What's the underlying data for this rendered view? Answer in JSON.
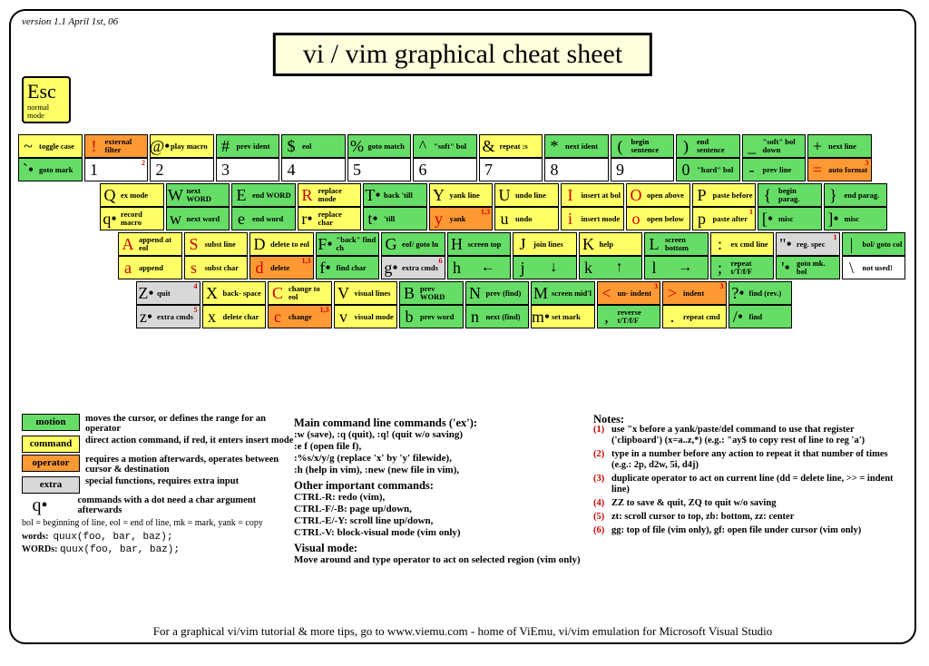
{
  "version": "version 1.1\nApril 1st, 06",
  "title": "vi / vim graphical cheat sheet",
  "esc": {
    "key": "Esc",
    "label": "normal mode"
  },
  "rows": [
    [
      {
        "upper": {
          "c": "~",
          "t": "g-cmd",
          "l": "toggle case"
        },
        "lower": {
          "c": "`•",
          "t": "g-motion",
          "l": "goto mark"
        }
      },
      {
        "upper": {
          "c": "!",
          "t": "g-op",
          "l": "external filter",
          "red": 1
        },
        "lower": {
          "c": "1",
          "t": "g-none",
          "l": "",
          "sup": "2",
          "dbl": 1
        }
      },
      {
        "upper": {
          "c": "@•",
          "t": "g-cmd",
          "l": "play macro"
        },
        "lower": {
          "c": "2",
          "t": "g-none",
          "l": "",
          "dbl": 1
        }
      },
      {
        "upper": {
          "c": "#",
          "t": "g-motion",
          "l": "prev ident"
        },
        "lower": {
          "c": "3",
          "t": "g-none",
          "l": "",
          "dbl": 1
        }
      },
      {
        "upper": {
          "c": "$",
          "t": "g-motion",
          "l": "eol"
        },
        "lower": {
          "c": "4",
          "t": "g-none",
          "l": "",
          "dbl": 1
        }
      },
      {
        "upper": {
          "c": "%",
          "t": "g-motion",
          "l": "goto match"
        },
        "lower": {
          "c": "5",
          "t": "g-none",
          "l": "",
          "dbl": 1
        }
      },
      {
        "upper": {
          "c": "^",
          "t": "g-motion",
          "l": "\"soft\" bol"
        },
        "lower": {
          "c": "6",
          "t": "g-none",
          "l": "",
          "dbl": 1
        }
      },
      {
        "upper": {
          "c": "&",
          "t": "g-cmd",
          "l": "repeat :s"
        },
        "lower": {
          "c": "7",
          "t": "g-none",
          "l": "",
          "dbl": 1
        }
      },
      {
        "upper": {
          "c": "*",
          "t": "g-motion",
          "l": "next ident"
        },
        "lower": {
          "c": "8",
          "t": "g-none",
          "l": "",
          "dbl": 1
        }
      },
      {
        "upper": {
          "c": "(",
          "t": "g-motion",
          "l": "begin sentence"
        },
        "lower": {
          "c": "9",
          "t": "g-none",
          "l": "",
          "dbl": 1
        }
      },
      {
        "upper": {
          "c": ")",
          "t": "g-motion",
          "l": "end sentence"
        },
        "lower": {
          "c": "0",
          "t": "g-motion",
          "l": "\"hard\" bol"
        }
      },
      {
        "upper": {
          "c": "_",
          "t": "g-motion",
          "l": "\"soft\" bol down"
        },
        "lower": {
          "c": "-",
          "t": "g-motion",
          "l": "prev line"
        }
      },
      {
        "upper": {
          "c": "+",
          "t": "g-motion",
          "l": "next line"
        },
        "lower": {
          "c": "=",
          "t": "g-op",
          "l": "auto format",
          "sup": "3",
          "red": 1
        }
      }
    ],
    [
      {
        "upper": {
          "c": "Q",
          "t": "g-cmd",
          "l": "ex mode"
        },
        "lower": {
          "c": "q•",
          "t": "g-cmd",
          "l": "record macro"
        }
      },
      {
        "upper": {
          "c": "W",
          "t": "g-motion",
          "l": "next WORD"
        },
        "lower": {
          "c": "w",
          "t": "g-motion",
          "l": "next word"
        }
      },
      {
        "upper": {
          "c": "E",
          "t": "g-motion",
          "l": "end WORD"
        },
        "lower": {
          "c": "e",
          "t": "g-motion",
          "l": "end word"
        }
      },
      {
        "upper": {
          "c": "R",
          "t": "g-cmd",
          "l": "replace mode",
          "red": 1
        },
        "lower": {
          "c": "r•",
          "t": "g-cmd",
          "l": "replace char"
        }
      },
      {
        "upper": {
          "c": "T•",
          "t": "g-motion",
          "l": "back 'till"
        },
        "lower": {
          "c": "t•",
          "t": "g-motion",
          "l": "'till"
        }
      },
      {
        "upper": {
          "c": "Y",
          "t": "g-cmd",
          "l": "yank line"
        },
        "lower": {
          "c": "y",
          "t": "g-op",
          "l": "yank",
          "sup": "1,3",
          "red": 1
        }
      },
      {
        "upper": {
          "c": "U",
          "t": "g-cmd",
          "l": "undo line"
        },
        "lower": {
          "c": "u",
          "t": "g-cmd",
          "l": "undo"
        }
      },
      {
        "upper": {
          "c": "I",
          "t": "g-cmd",
          "l": "insert at bol",
          "red": 1
        },
        "lower": {
          "c": "i",
          "t": "g-cmd",
          "l": "insert mode",
          "red": 1
        }
      },
      {
        "upper": {
          "c": "O",
          "t": "g-cmd",
          "l": "open above",
          "red": 1
        },
        "lower": {
          "c": "o",
          "t": "g-cmd",
          "l": "open below",
          "red": 1
        }
      },
      {
        "upper": {
          "c": "P",
          "t": "g-cmd",
          "l": "paste before"
        },
        "lower": {
          "c": "p",
          "t": "g-cmd",
          "l": "paste after",
          "sup": "1"
        }
      },
      {
        "upper": {
          "c": "{",
          "t": "g-motion",
          "l": "begin parag."
        },
        "lower": {
          "c": "[•",
          "t": "g-motion",
          "l": "misc"
        }
      },
      {
        "upper": {
          "c": "}",
          "t": "g-motion",
          "l": "end parag."
        },
        "lower": {
          "c": "]•",
          "t": "g-motion",
          "l": "misc"
        }
      }
    ],
    [
      {
        "upper": {
          "c": "A",
          "t": "g-cmd",
          "l": "append at eol",
          "red": 1
        },
        "lower": {
          "c": "a",
          "t": "g-cmd",
          "l": "append",
          "red": 1
        }
      },
      {
        "upper": {
          "c": "S",
          "t": "g-cmd",
          "l": "subst line",
          "red": 1
        },
        "lower": {
          "c": "s",
          "t": "g-cmd",
          "l": "subst char",
          "red": 1
        }
      },
      {
        "upper": {
          "c": "D",
          "t": "g-cmd",
          "l": "delete to eol"
        },
        "lower": {
          "c": "d",
          "t": "g-op",
          "l": "delete",
          "sup": "1,3",
          "red": 1
        }
      },
      {
        "upper": {
          "c": "F•",
          "t": "g-motion",
          "l": "\"back\" find ch"
        },
        "lower": {
          "c": "f•",
          "t": "g-motion",
          "l": "find char"
        }
      },
      {
        "upper": {
          "c": "G",
          "t": "g-motion",
          "l": "eof/ goto ln"
        },
        "lower": {
          "c": "g•",
          "t": "g-extra",
          "l": "extra cmds",
          "sup": "6"
        }
      },
      {
        "upper": {
          "c": "H",
          "t": "g-motion",
          "l": "screen top"
        },
        "lower": {
          "c": "h",
          "t": "g-motion",
          "arrow": "←"
        }
      },
      {
        "upper": {
          "c": "J",
          "t": "g-cmd",
          "l": "join lines"
        },
        "lower": {
          "c": "j",
          "t": "g-motion",
          "arrow": "↓"
        }
      },
      {
        "upper": {
          "c": "K",
          "t": "g-cmd",
          "l": "help"
        },
        "lower": {
          "c": "k",
          "t": "g-motion",
          "arrow": "↑"
        }
      },
      {
        "upper": {
          "c": "L",
          "t": "g-motion",
          "l": "screen bottom"
        },
        "lower": {
          "c": "l",
          "t": "g-motion",
          "arrow": "→"
        }
      },
      {
        "upper": {
          "c": ":",
          "t": "g-cmd",
          "l": "ex cmd line"
        },
        "lower": {
          "c": ";",
          "t": "g-motion",
          "l": "repeat t/T/f/F"
        }
      },
      {
        "upper": {
          "c": "\"•",
          "t": "g-extra",
          "l": "reg. spec",
          "sup": "1"
        },
        "lower": {
          "c": "'•",
          "t": "g-motion",
          "l": "goto mk. bol"
        }
      },
      {
        "upper": {
          "c": "|",
          "t": "g-motion",
          "l": "bol/ goto col"
        },
        "lower": {
          "c": "\\",
          "t": "g-none",
          "l": "not used!"
        }
      }
    ],
    [
      {
        "upper": {
          "c": "Z•",
          "t": "g-extra",
          "l": "quit",
          "sup": "4"
        },
        "lower": {
          "c": "z•",
          "t": "g-extra",
          "l": "extra cmds",
          "sup": "5"
        }
      },
      {
        "upper": {
          "c": "X",
          "t": "g-cmd",
          "l": "back- space"
        },
        "lower": {
          "c": "x",
          "t": "g-cmd",
          "l": "delete char"
        }
      },
      {
        "upper": {
          "c": "C",
          "t": "g-cmd",
          "l": "change to eol",
          "red": 1
        },
        "lower": {
          "c": "c",
          "t": "g-op",
          "l": "change",
          "red": 1,
          "sup": "1,3"
        }
      },
      {
        "upper": {
          "c": "V",
          "t": "g-cmd",
          "l": "visual lines"
        },
        "lower": {
          "c": "v",
          "t": "g-cmd",
          "l": "visual mode"
        }
      },
      {
        "upper": {
          "c": "B",
          "t": "g-motion",
          "l": "prev WORD"
        },
        "lower": {
          "c": "b",
          "t": "g-motion",
          "l": "prev word"
        }
      },
      {
        "upper": {
          "c": "N",
          "t": "g-motion",
          "l": "prev (find)"
        },
        "lower": {
          "c": "n",
          "t": "g-motion",
          "l": "next (find)"
        }
      },
      {
        "upper": {
          "c": "M",
          "t": "g-motion",
          "l": "screen mid'l"
        },
        "lower": {
          "c": "m•",
          "t": "g-cmd",
          "l": "set mark"
        }
      },
      {
        "upper": {
          "c": "<",
          "t": "g-op",
          "l": "un- indent",
          "sup": "3",
          "red": 1
        },
        "lower": {
          "c": ",",
          "t": "g-motion",
          "l": "reverse t/T/f/F"
        }
      },
      {
        "upper": {
          "c": ">",
          "t": "g-op",
          "l": "indent",
          "sup": "3",
          "red": 1
        },
        "lower": {
          "c": ".",
          "t": "g-cmd",
          "l": "repeat cmd"
        }
      },
      {
        "upper": {
          "c": "?•",
          "t": "g-motion",
          "l": "find (rev.)"
        },
        "lower": {
          "c": "/•",
          "t": "g-motion",
          "l": "find"
        }
      }
    ]
  ],
  "row_offset": [
    0,
    90,
    110,
    130
  ],
  "legend": [
    {
      "t": "g-motion",
      "n": "motion",
      "d": "moves the cursor, or defines the range for an operator"
    },
    {
      "t": "g-cmd",
      "n": "command",
      "d": "direct action command, if red, it enters insert mode"
    },
    {
      "t": "g-op",
      "n": "operator",
      "d": "requires a motion afterwards, operates between cursor & destination"
    },
    {
      "t": "g-extra",
      "n": "extra",
      "d": "special functions, requires extra input"
    }
  ],
  "qdot": "commands with a dot need a char argument afterwards",
  "abbrev": "bol = beginning of line, eol = end of line, mk = mark, yank = copy",
  "words_label": "words:",
  "WORDS_label": "WORDs:",
  "wexample": "quux(foo, bar, baz);",
  "main_h": "Main command line commands ('ex'):",
  "main_lines": [
    ":w (save), :q (quit), :q! (quit w/o saving)",
    ":e f (open file f),",
    ":%s/x/y/g (replace 'x' by 'y' filewide),",
    ":h (help in vim), :new (new file in vim),"
  ],
  "other_h": "Other important commands:",
  "other_lines": [
    "CTRL-R: redo (vim),",
    "CTRL-F/-B: page up/down,",
    "CTRL-E/-Y: scroll line up/down,",
    "CTRL-V: block-visual mode (vim only)"
  ],
  "visual_h": "Visual mode:",
  "visual_lines": [
    "Move around and type operator to act on selected region (vim only)"
  ],
  "notes_h": "Notes:",
  "notes": [
    {
      "n": "(1)",
      "t": "use \"x before a yank/paste/del command to use that register ('clipboard') (x=a..z,*) (e.g.: \"ay$ to copy rest of line to reg 'a')"
    },
    {
      "n": "(2)",
      "t": "type in a number before any action to repeat it that number of times (e.g.: 2p, d2w, 5i, d4j)"
    },
    {
      "n": "(3)",
      "t": "duplicate operator to act on current line (dd = delete line, >> = indent line)"
    },
    {
      "n": "(4)",
      "t": "ZZ to save & quit, ZQ to quit w/o saving"
    },
    {
      "n": "(5)",
      "t": "zt: scroll cursor to top, zb: bottom, zz: center"
    },
    {
      "n": "(6)",
      "t": "gg: top of file (vim only), gf: open file under cursor (vim only)"
    }
  ],
  "footer": "For a graphical vi/vim tutorial & more tips, go to   www.viemu.com   - home of ViEmu, vi/vim emulation for Microsoft Visual Studio"
}
